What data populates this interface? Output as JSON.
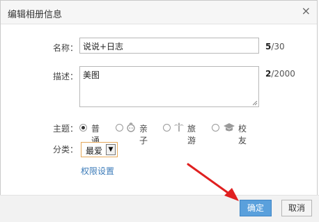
{
  "dialog": {
    "title": "编辑相册信息",
    "close_glyph": "×"
  },
  "form": {
    "name_label": "名称：",
    "name_value": "说说+日志",
    "name_count": "5",
    "name_max": "/30",
    "desc_label": "描述：",
    "desc_value": "美图",
    "desc_count": "2",
    "desc_max": "/2000",
    "theme_label": "主题：",
    "themes": [
      {
        "label": "普通",
        "icon": "",
        "checked": true
      },
      {
        "label": "亲子",
        "icon": "baby-face-icon",
        "checked": false
      },
      {
        "label": "旅游",
        "icon": "palm-tree-icon",
        "checked": false
      },
      {
        "label": "校友",
        "icon": "graduation-cap-icon",
        "checked": false
      }
    ],
    "category_label": "分类：",
    "category_value": "最爱",
    "permission_link": "权限设置"
  },
  "buttons": {
    "confirm": "确定",
    "cancel": "取消"
  },
  "colors": {
    "primary_button": "#5aa0dc",
    "link": "#3a7ab8",
    "annotation_arrow": "#e02020"
  }
}
